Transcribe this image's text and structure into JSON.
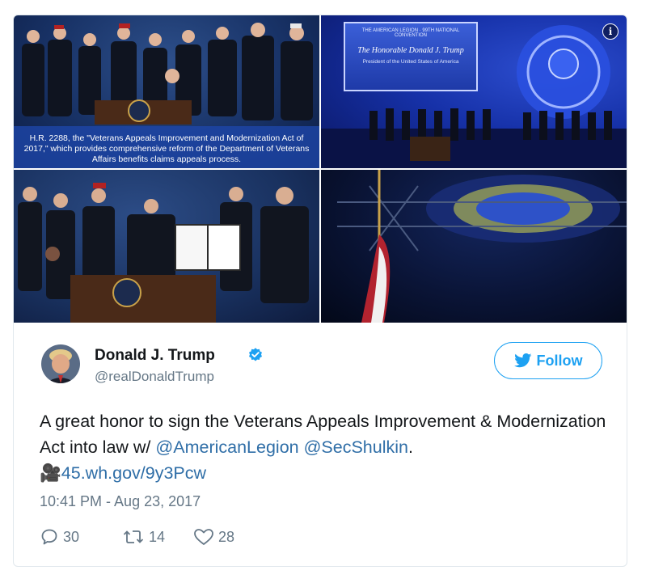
{
  "media": {
    "caption": "H.R. 2288, the \"Veterans Appeals Improvement and Modernization Act of 2017,\" which provides comprehensive reform of the Department of Veterans Affairs benefits claims appeals process.",
    "screen_title": "THE AMERICAN LEGION · 99TH NATIONAL CONVENTION",
    "screen_name": "The Honorable Donald J. Trump",
    "screen_sub": "President of the United States of America",
    "info_icon": "info-icon"
  },
  "tweet": {
    "author_name": "Donald J. Trump",
    "author_handle": "@realDonaldTrump",
    "follow_label": "Follow",
    "text_plain": "A great honor to sign the Veterans Appeals Improvement & Modernization Act into law w/",
    "mention_1": "@AmericanLegion",
    "mention_2": "@SecShulkin",
    "period": ".",
    "camera_emoji": "🎥",
    "link": "45.wh.gov/9y3Pcw",
    "timestamp": "10:41 PM - Aug 23, 2017",
    "replies": "30",
    "retweets": "14",
    "likes": "28"
  },
  "colors": {
    "accent": "#1da1f2",
    "link": "#2f6ea7",
    "muted": "#657786",
    "text": "#14171a"
  }
}
